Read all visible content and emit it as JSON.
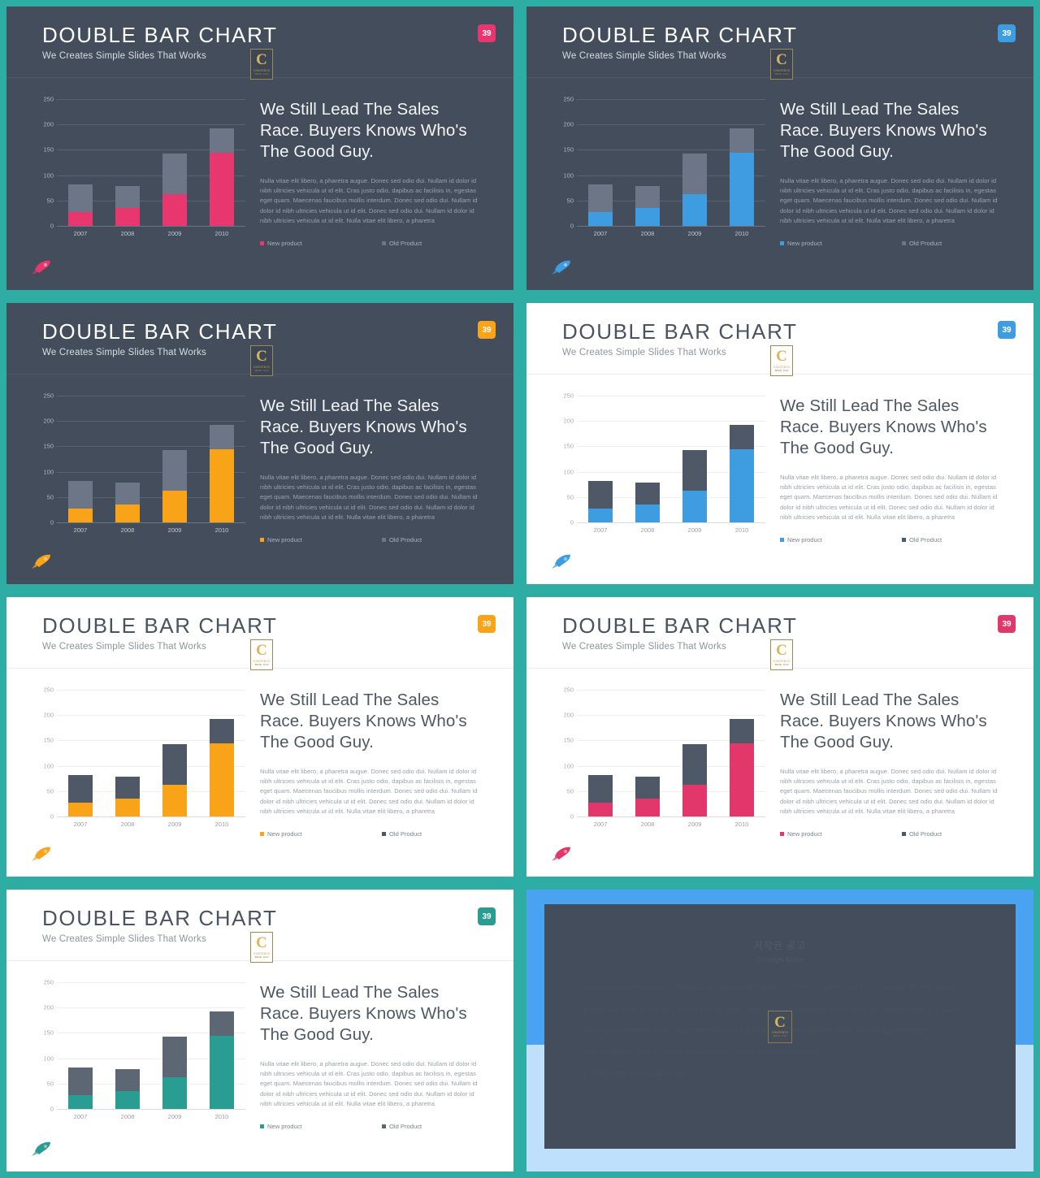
{
  "deck": {
    "background_color": "#2eada5",
    "slide_title": "DOUBLE BAR CHART",
    "slide_subtitle": "We Creates Simple Slides That Works",
    "page_number": "39",
    "headline": "We Still Lead The Sales Race. Buyers Knows Who's The Good Guy.",
    "body_paragraph": "Nulla vitae elit libero, a pharetra augue. Donec sed odio dui. Nullam id dolor id nibh ultricies vehicula ut id elit. Cras justo odio, dapibus ac facilisis in, egestas eget quam. Maecenas faucibus mollis interdum. Donec sed odio dui. Nullam id dolor id nibh ultricies vehicula ut id elit. Donec sed odio dui. Nullam id dolor id nibh ultricies vehicula ut id elit. Nulla vitae elit libero, a pharetra",
    "logo": {
      "letter": "C",
      "wordmark": "CONTENTS",
      "tagline": "BRAND . PLAN"
    },
    "pin_icon": "rocket-pin-icon"
  },
  "chart_data": {
    "type": "bar",
    "subtype": "stacked",
    "title": "DOUBLE BAR CHART",
    "categories": [
      "2007",
      "2008",
      "2009",
      "2010"
    ],
    "series": [
      {
        "name": "New product",
        "values": [
          27,
          36,
          63,
          144
        ]
      },
      {
        "name": "Old Product",
        "values": [
          54,
          43,
          80,
          48
        ]
      }
    ],
    "totals": [
      81,
      79,
      143,
      192
    ],
    "xlabel": "",
    "ylabel": "",
    "ylim": [
      0,
      250
    ],
    "yticks": [
      0,
      50,
      100,
      150,
      200,
      250
    ],
    "grid": true,
    "legend_position": "bottom",
    "legend": [
      "New product",
      "Old Product"
    ]
  },
  "variants": [
    {
      "id": "pink-dark",
      "theme": "dark",
      "accent": "#e8376f",
      "old_color": "#6c7687",
      "border": "#2eada5"
    },
    {
      "id": "blue-dark",
      "theme": "dark",
      "accent": "#3d9de0",
      "old_color": "#6c7687",
      "border": "#2eada5"
    },
    {
      "id": "orange-dark",
      "theme": "dark",
      "accent": "#f9a319",
      "old_color": "#6c7687",
      "border": "#2eada5"
    },
    {
      "id": "blue-light",
      "theme": "light",
      "accent": "#3d9de0",
      "old_color": "#4e5867",
      "border": "#2eada5"
    },
    {
      "id": "orange-light",
      "theme": "light",
      "accent": "#f9a319",
      "old_color": "#4e5867",
      "border": "#2eada5"
    },
    {
      "id": "pink-light",
      "theme": "light",
      "accent": "#e2376a",
      "old_color": "#4e5867",
      "border": "#2eada5"
    },
    {
      "id": "teal-light",
      "theme": "light",
      "accent": "#2a9d93",
      "old_color": "#5d6673",
      "border": "#2eada5"
    }
  ],
  "copyright_slide": {
    "title_ko": "저작권 공고",
    "title_en": "Copyright Notice",
    "paragraphs": [
      "본 저작물은 저작권법에 의하여 보호받는 저작물이므로 무단 전재와 무단 복제를 금지하며, 내용의 전부 또는 일부를 이용하려면 반드시 저작권자의 서면 동의를 받아야 합니다.",
      "본 템플릿의 모든 이미지 및 디자인 요소는 제작자에게 저작권이 있으며, 구매자는 개인 및 상업적 프레젠테이션 용도로 사용할 수 있으나 재판매 및 재배포는 할 수 없습니다.",
      "템플릿 파일을 수정하여 제작한 결과물의 저작권은 구매자에게 있으나, 원본 템플릿 자체를 제3자에게 양도하거나 공유하는 행위는 저작권법 위반에 해당합니다.",
      "저작권 관련 문의사항이 있으시면 고객센터로 연락 주시기 바랍니다. 신속하고 정확한 안내를 도와드리겠습니다.",
      "본 저작물을 구입해 주셔서 진심으로 감사드립니다."
    ],
    "frame_color": "#4aa3f0",
    "band_color": "#bfe0fb"
  }
}
